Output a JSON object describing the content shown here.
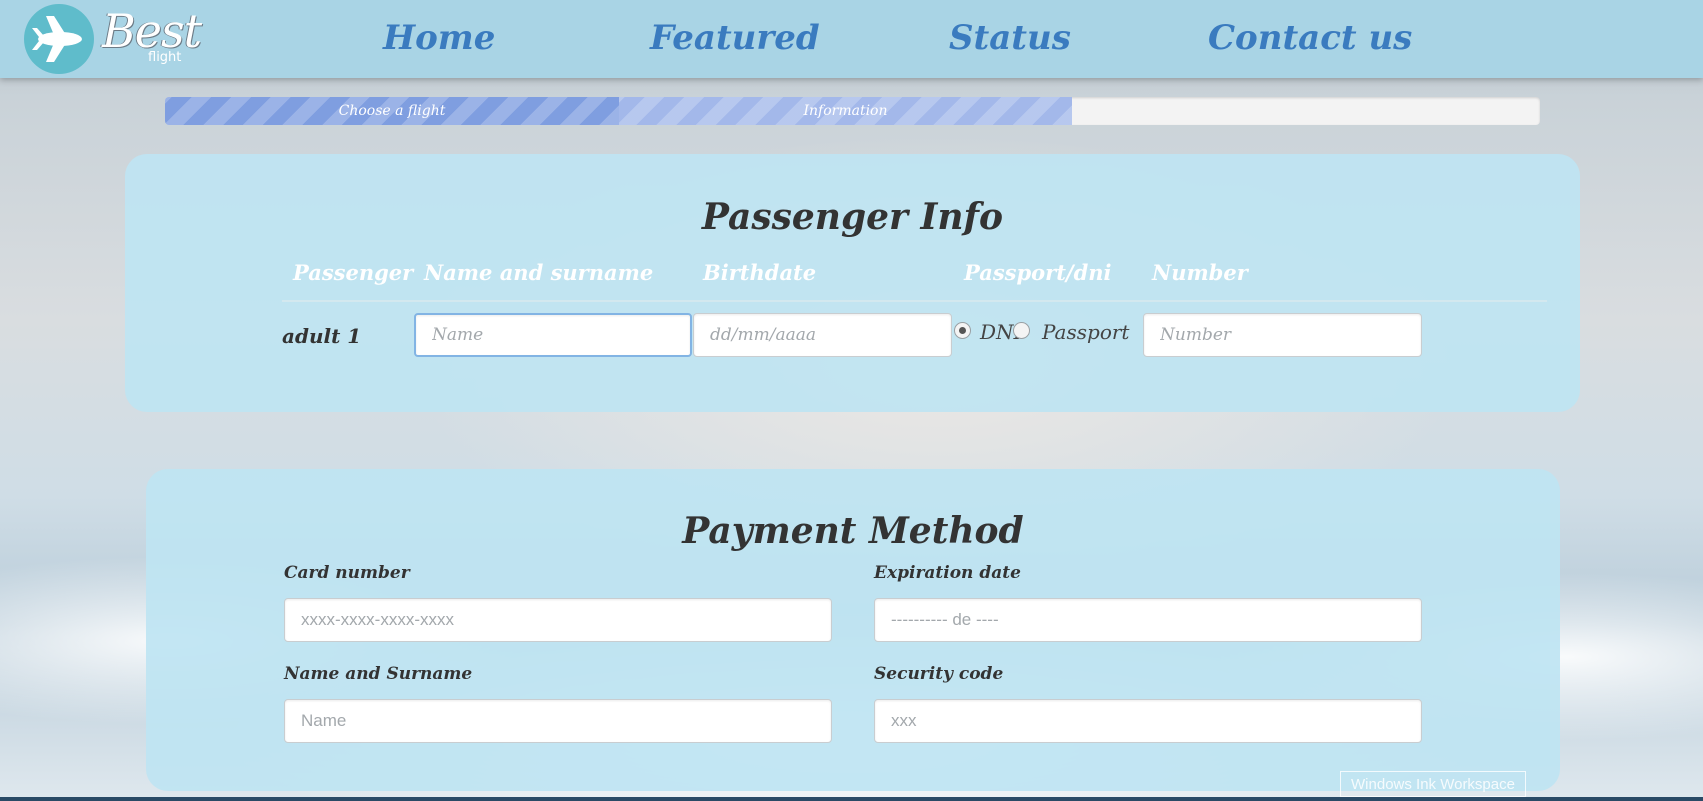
{
  "brand": {
    "name": "Best",
    "sub": "flight",
    "logo_icon": "airplane-icon"
  },
  "nav": [
    {
      "label": "Home"
    },
    {
      "label": "Featured"
    },
    {
      "label": "Status"
    },
    {
      "label": "Contact us"
    }
  ],
  "progress": {
    "steps": [
      {
        "label": "Choose a flight",
        "state": "completed"
      },
      {
        "label": "Information",
        "state": "current"
      }
    ],
    "fraction_complete": 0.66
  },
  "passenger": {
    "title": "Passenger Info",
    "columns": [
      "Passenger",
      "Name and surname",
      "Birthdate",
      "Passport/dni",
      "Number"
    ],
    "rows": [
      {
        "label": "adult 1",
        "name_placeholder": "Name",
        "birthdate_placeholder": "dd/mm/aaaa",
        "doc_options": [
          "DNI",
          "Passport"
        ],
        "doc_selected": "DNI",
        "number_placeholder": "Number"
      }
    ]
  },
  "payment": {
    "title": "Payment Method",
    "card_number": {
      "label": "Card number",
      "placeholder": "xxxx-xxxx-xxxx-xxxx"
    },
    "expiration": {
      "label": "Expiration date",
      "placeholder": "---------- de ----"
    },
    "name": {
      "label": "Name and Surname",
      "placeholder": "Name"
    },
    "security": {
      "label": "Security code",
      "placeholder": "xxx"
    }
  },
  "system": {
    "ink_workspace": "Windows Ink Workspace"
  },
  "colors": {
    "header": "#a9d4e5",
    "nav_text": "#3a7bbf",
    "card_bg": "#bee4f2",
    "progress_done": "#7f9ee0",
    "progress_current": "#a3b8ea"
  }
}
